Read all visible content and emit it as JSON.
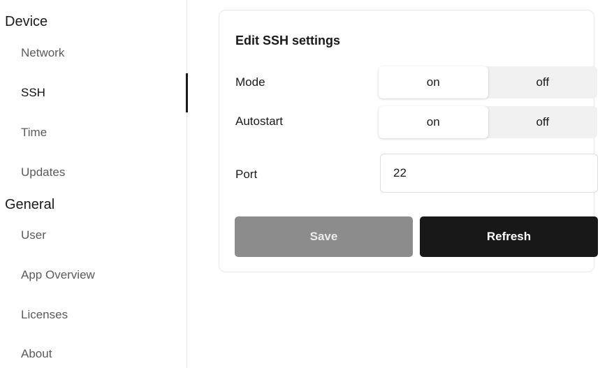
{
  "sidebar": {
    "groups": [
      {
        "label": "Device",
        "items": [
          "Network",
          "SSH",
          "Time",
          "Updates"
        ]
      },
      {
        "label": "General",
        "items": [
          "User",
          "App Overview",
          "Licenses",
          "About"
        ]
      }
    ],
    "active_item": "SSH"
  },
  "ssh_settings": {
    "title": "Edit SSH settings",
    "mode": {
      "label": "Mode",
      "on_label": "on",
      "off_label": "off",
      "selected": "on"
    },
    "autostart": {
      "label": "Autostart",
      "on_label": "on",
      "off_label": "off",
      "selected": "on"
    },
    "port": {
      "label": "Port",
      "value": "22"
    },
    "save_label": "Save",
    "refresh_label": "Refresh"
  },
  "colors": {
    "accent": "#1a1a1a",
    "save_disabled": "#8c8c8c",
    "refresh_bg": "#181818",
    "toggle_bg": "#f1f1f1"
  }
}
